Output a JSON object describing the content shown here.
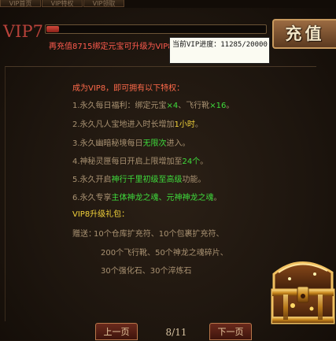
{
  "tabs": [
    "VIP首页",
    "VIP特权",
    "VIP领取"
  ],
  "header": {
    "vip_level": "VIP7",
    "progress_fraction": 0.0561,
    "charge_label": "充值",
    "hint": "再充值8715绑定元宝可升级为VIP8"
  },
  "tooltip": {
    "text": "当前VIP进度：11285/20000"
  },
  "benefits": {
    "title": "成为VIP8，即可拥有以下特权：",
    "items": [
      {
        "a": "1.永久每日福利：绑定元宝",
        "b": "×4",
        "c": "、飞行靴",
        "d": "×16",
        "e": "。"
      },
      {
        "a": "2.永久凡人宝地进入时长增加",
        "b": "1小时",
        "c": "。"
      },
      {
        "a": "3.永久幽暗秘境每日",
        "b": "无限次",
        "c": "进入。"
      },
      {
        "a": "4.神秘灵匣每日开启上限增加至",
        "b": "24个",
        "c": "。"
      },
      {
        "a": "5.永久开启",
        "b": "神行千里初级至高级",
        "c": "功能。"
      },
      {
        "a": "6.永久专享",
        "b": "主体神龙之魂、元神神龙之魂",
        "c": "。"
      }
    ]
  },
  "gift": {
    "title": "VIP8升级礼包：",
    "label": "赠送：",
    "lines": [
      "10个仓库扩充符、10个包裹扩充符、",
      "200个飞行靴、50个神龙之魂碎片、",
      "30个强化石、30个淬炼石"
    ]
  },
  "footer": {
    "prev_label": "上一页",
    "page": "8/11",
    "next_label": "下一页"
  },
  "colors": {
    "accent_red": "#ff5b4e",
    "highlight_green": "#3fdc3c",
    "highlight_yellow": "#f2d23b",
    "body_text": "#a99272"
  },
  "icons": [
    "treasure-chest-icon"
  ]
}
